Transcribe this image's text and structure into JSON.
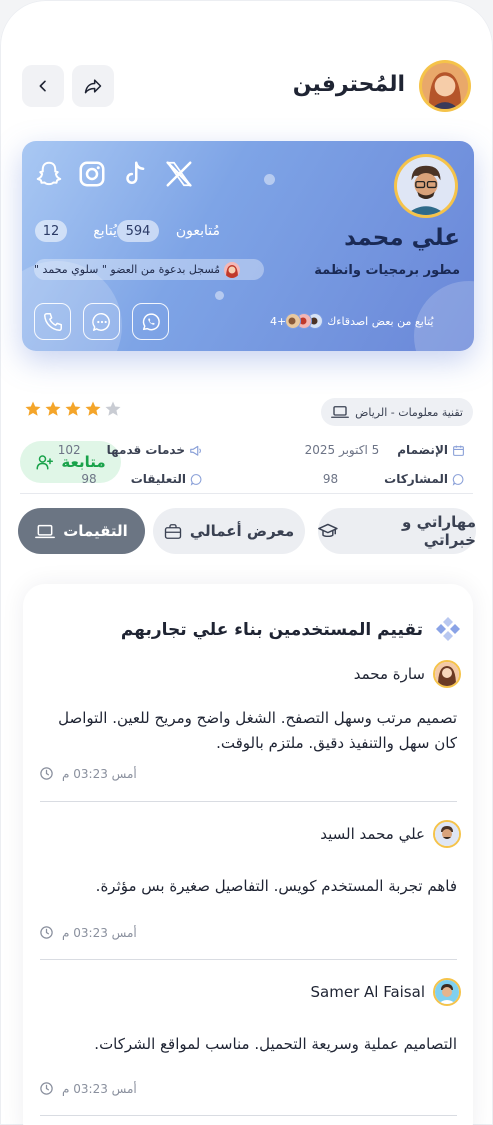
{
  "header": {
    "title": "المُحترفين"
  },
  "profile": {
    "name": "علي محمد",
    "role": "مطور برمجيات وانظمة",
    "followers_label": "مُتابعون",
    "followers_count": "594",
    "following_label": "يُتابع",
    "following_count": "12",
    "invite_text": "مُسجل بدعوة من العضو \" سلوي محمد \"",
    "friends_text": "يُتابع من بعض اصدقاءك",
    "friends_more": "4+",
    "social": [
      "x-icon",
      "tiktok-icon",
      "instagram-icon",
      "snapchat-icon"
    ],
    "contact": [
      "whatsapp-icon",
      "message-icon",
      "phone-icon"
    ]
  },
  "rating": {
    "value": 4,
    "max": 5
  },
  "location": "تقنية معلومات - الرياض",
  "follow_button": "متابعة",
  "info": {
    "joined_label": "الإنضمام",
    "joined_value": "5 اكتوبر 2025",
    "services_label": "خدمات قدمها",
    "services_value": "102",
    "posts_label": "المشاركات",
    "posts_value": "98",
    "comments_label": "التعليقات",
    "comments_value": "98"
  },
  "tabs": [
    {
      "label": "مهاراتي و خبراتي",
      "icon": "graduation-cap-icon"
    },
    {
      "label": "معرض أعمالي",
      "icon": "briefcase-icon"
    },
    {
      "label": "التقيمات",
      "icon": "laptop-icon",
      "active": true
    }
  ],
  "reviews": {
    "title": "تقييم المستخدمين بناء علي تجاربهم",
    "items": [
      {
        "author": "سارة محمد",
        "text": "تصميم مرتب وسهل التصفح. الشغل واضح ومريح للعين. التواصل كان سهل والتنفيذ دقيق. ملتزم بالوقت.",
        "time": "أمس 03:23 م"
      },
      {
        "author": "علي محمد السيد",
        "text": "فاهم تجربة المستخدم كويس. التفاصيل صغيرة بس مؤثرة.",
        "time": "أمس 03:23 م"
      },
      {
        "author": "Samer Al Faisal",
        "text": "التصاميم عملية وسريعة التحميل. مناسب لمواقع الشركات.",
        "time": "أمس 03:23 م"
      }
    ]
  },
  "colors": {
    "accent": "#6a87d8",
    "star": "#f4a52a",
    "follow": "#19a24a",
    "active_tab": "#6b7583"
  }
}
